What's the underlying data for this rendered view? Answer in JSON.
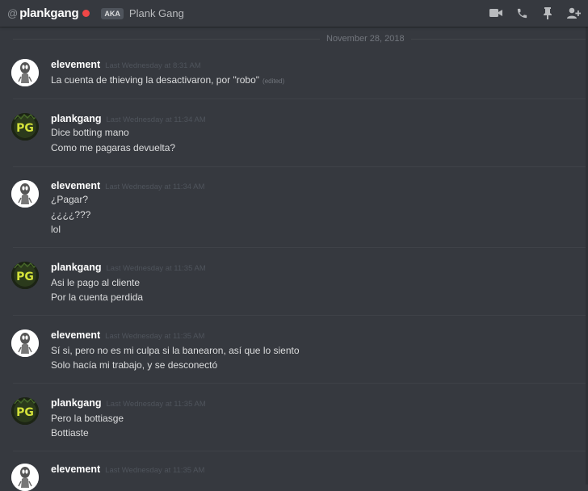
{
  "header": {
    "at_symbol": "@",
    "username": "plankgang",
    "status_color": "#f04747",
    "aka_badge": "AKA",
    "aka_name": "Plank Gang",
    "icons": [
      "video-call-icon",
      "voice-call-icon",
      "pinned-messages-icon",
      "add-friend-to-dm-icon"
    ]
  },
  "date_divider": "November 28, 2018",
  "messages": [
    {
      "author": "elevement",
      "timestamp": "Last Wednesday at 8:31 AM",
      "lines": [
        "La cuenta de thieving la desactivaron, por \"robo\""
      ],
      "edited_label": "(edited)"
    },
    {
      "author": "plankgang",
      "timestamp": "Last Wednesday at 11:34 AM",
      "lines": [
        "Dice botting mano",
        "Como me pagaras devuelta?"
      ]
    },
    {
      "author": "elevement",
      "timestamp": "Last Wednesday at 11:34 AM",
      "lines": [
        "¿Pagar?",
        "¿¿¿¿???",
        "lol"
      ]
    },
    {
      "author": "plankgang",
      "timestamp": "Last Wednesday at 11:35 AM",
      "lines": [
        "Asi le pago al cliente",
        "Por la cuenta perdida"
      ]
    },
    {
      "author": "elevement",
      "timestamp": "Last Wednesday at 11:35 AM",
      "lines": [
        "Sí si, pero no es mi culpa si la banearon, así que lo siento",
        "Solo hacía mi trabajo, y se desconectó"
      ]
    },
    {
      "author": "plankgang",
      "timestamp": "Last Wednesday at 11:35 AM",
      "lines": [
        "Pero la bottiasge",
        "Bottiaste"
      ]
    },
    {
      "author": "elevement",
      "timestamp": "Last Wednesday at 11:35 AM",
      "lines": []
    }
  ]
}
